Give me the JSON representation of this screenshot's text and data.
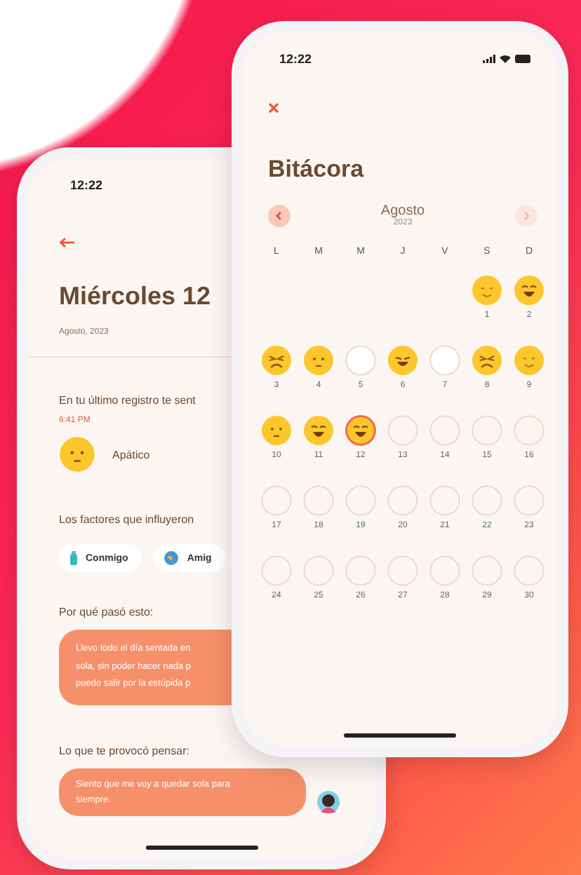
{
  "back_screen": {
    "status_time": "12:22",
    "title": "Miércoles 12",
    "date": "Agosto, 2023",
    "last_entry_label": "En tu último registro te sent",
    "last_entry_time": "6:41 PM",
    "mood": {
      "kind": "neutral",
      "label": "Apático"
    },
    "factors_label": "Los factores que influyeron",
    "factors": [
      {
        "label": "Conmigo",
        "kind": "bottle"
      },
      {
        "label": "Amig",
        "kind": "globe"
      }
    ],
    "reason_label": "Por qué pasó esto:",
    "reason_lines": [
      "Llevo todo el día sentada en",
      "sola, sin poder hacer nada p",
      "puedo salir por la estúpida p"
    ],
    "thought_label": "Lo que te provocó pensar:",
    "thought": "Siento que me voy a quedar sola para siempre."
  },
  "front_screen": {
    "status_time": "12:22",
    "title": "Bitácora",
    "month": "Agosto",
    "year": "2023",
    "prev": {
      "disabled": false
    },
    "next": {
      "disabled": true
    },
    "weekdays": [
      "L",
      "M",
      "M",
      "J",
      "V",
      "S",
      "D"
    ],
    "weeks": [
      {
        "kind": "partial",
        "days": [
          {
            "label": "1",
            "kind": "smile",
            "selected": false
          },
          {
            "label": "2",
            "kind": "laugh",
            "selected": false
          }
        ]
      },
      {
        "kind": "full",
        "days": [
          {
            "label": "3",
            "kind": "upset",
            "selected": false
          },
          {
            "label": "4",
            "kind": "neutral",
            "selected": false
          },
          {
            "label": "5",
            "kind": "blank",
            "selected": false
          },
          {
            "label": "6",
            "kind": "grin",
            "selected": false
          },
          {
            "label": "7",
            "kind": "blank",
            "selected": false
          },
          {
            "label": "8",
            "kind": "upset",
            "selected": false
          },
          {
            "label": "9",
            "kind": "smile",
            "selected": false
          }
        ]
      },
      {
        "kind": "full",
        "days": [
          {
            "label": "10",
            "kind": "neutral",
            "selected": false
          },
          {
            "label": "11",
            "kind": "laugh",
            "selected": false
          },
          {
            "label": "12",
            "kind": "laugh",
            "selected": true
          },
          {
            "label": "13",
            "kind": "none",
            "selected": false
          },
          {
            "label": "14",
            "kind": "none",
            "selected": false
          },
          {
            "label": "15",
            "kind": "none",
            "selected": false
          },
          {
            "label": "16",
            "kind": "none",
            "selected": false
          }
        ]
      },
      {
        "kind": "full",
        "days": [
          {
            "label": "17",
            "kind": "none",
            "selected": false
          },
          {
            "label": "18",
            "kind": "none",
            "selected": false
          },
          {
            "label": "19",
            "kind": "none",
            "selected": false
          },
          {
            "label": "20",
            "kind": "none",
            "selected": false
          },
          {
            "label": "21",
            "kind": "none",
            "selected": false
          },
          {
            "label": "22",
            "kind": "none",
            "selected": false
          },
          {
            "label": "23",
            "kind": "none",
            "selected": false
          }
        ]
      },
      {
        "kind": "full",
        "days": [
          {
            "label": "24",
            "kind": "none",
            "selected": false
          },
          {
            "label": "25",
            "kind": "none",
            "selected": false
          },
          {
            "label": "26",
            "kind": "none",
            "selected": false
          },
          {
            "label": "27",
            "kind": "none",
            "selected": false
          },
          {
            "label": "28",
            "kind": "none",
            "selected": false
          },
          {
            "label": "29",
            "kind": "none",
            "selected": false
          },
          {
            "label": "30",
            "kind": "none",
            "selected": false
          }
        ]
      }
    ]
  }
}
